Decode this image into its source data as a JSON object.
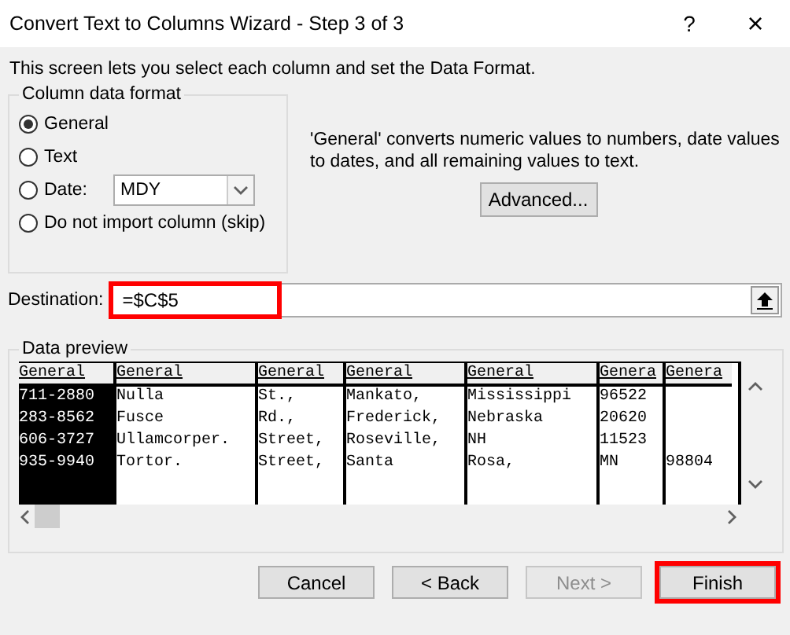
{
  "window": {
    "title": "Convert Text to Columns Wizard - Step 3 of 3",
    "help": "?",
    "close": "×"
  },
  "intro": "This screen lets you select each column and set the Data Format.",
  "format_group": {
    "title": "Column data format",
    "options": [
      {
        "label": "General",
        "selected": true,
        "kind": "radio"
      },
      {
        "label": "Text",
        "selected": false,
        "kind": "radio"
      },
      {
        "label": "Date:",
        "selected": false,
        "kind": "date",
        "value": "MDY"
      },
      {
        "label": "Do not import column (skip)",
        "selected": false,
        "kind": "radio"
      }
    ]
  },
  "description": "'General' converts numeric values to numbers, date values to dates, and all remaining values to text.",
  "advanced_button": "Advanced...",
  "destination": {
    "label": "Destination:",
    "value": "=$C$5",
    "highlighted": true
  },
  "preview": {
    "title": "Data preview",
    "columns": [
      {
        "header": "General",
        "selected": true
      },
      {
        "header": "General",
        "selected": false
      },
      {
        "header": "General",
        "selected": false
      },
      {
        "header": "General",
        "selected": false
      },
      {
        "header": "General",
        "selected": false
      },
      {
        "header": "Genera",
        "selected": false
      },
      {
        "header": "Genera",
        "selected": false
      }
    ],
    "rows": [
      [
        "711-2880",
        "Nulla",
        "St.,",
        "Mankato,",
        "Mississippi",
        "96522"
      ],
      [
        "283-8562",
        "Fusce",
        "Rd.,",
        "Frederick,",
        "Nebraska",
        "20620"
      ],
      [
        "606-3727",
        "Ullamcorper.",
        "Street,",
        "Roseville,",
        "NH",
        "11523"
      ],
      [
        "935-9940",
        "Tortor.",
        "Street,",
        "Santa",
        "Rosa,",
        "MN",
        "98804"
      ]
    ]
  },
  "buttons": [
    {
      "label": "Cancel",
      "disabled": false,
      "highlighted": false
    },
    {
      "label": "< Back",
      "disabled": false,
      "highlighted": false
    },
    {
      "label": "Next >",
      "disabled": true,
      "highlighted": false
    },
    {
      "label": "Finish",
      "disabled": false,
      "highlighted": true
    }
  ]
}
